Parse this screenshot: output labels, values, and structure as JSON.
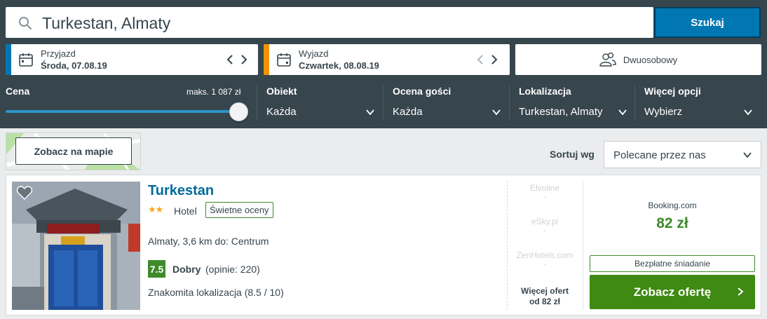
{
  "search": {
    "value": "Turkestan, Almaty",
    "button_label": "Szukaj"
  },
  "checkin": {
    "label": "Przyjazd",
    "date": "Środa, 07.08.19",
    "accent_color": "#0077b3"
  },
  "checkout": {
    "label": "Wyjazd",
    "date": "Czwartek, 08.08.19",
    "accent_color": "#f39200"
  },
  "room": {
    "label": "Dwuosobowy",
    "icon": "people-icon"
  },
  "filters": {
    "price": {
      "label": "Cena",
      "max_label": "maks. 1 087 zł",
      "slider_fraction": 1.0
    },
    "property": {
      "label": "Obiekt",
      "value": "Każda"
    },
    "guest_rating": {
      "label": "Ocena gości",
      "value": "Każda"
    },
    "location": {
      "label": "Lokalizacja",
      "value": "Turkestan, Almaty"
    },
    "more": {
      "label": "Więcej opcji",
      "value": "Wybierz"
    }
  },
  "map": {
    "button_label": "Zobacz na mapie"
  },
  "sort": {
    "label": "Sortuj wg",
    "value": "Polecane przez nas"
  },
  "result": {
    "name": "Turkestan",
    "stars": "★★",
    "star_count": 2,
    "type": "Hotel",
    "badge": "Świetne oceny",
    "location": "Almaty, 3,6 km do: Centrum",
    "score": "7.5",
    "rating_word": "Dobry",
    "reviews": "(opinie: 220)",
    "location_score": "Znakomita lokalizacja (8.5 / 10)",
    "other_offers": [
      {
        "name": "Elvoline",
        "price": "-"
      },
      {
        "name": "eSky.pl",
        "price": "-"
      },
      {
        "name": "ZenHotels.com",
        "price": "-"
      }
    ],
    "more_offers_line1": "Więcej ofert",
    "more_offers_line2": "od 82 zł",
    "provider": "Booking.com",
    "price": "82 zł",
    "perk": "Bezpłatne śniadanie",
    "cta_label": "Zobacz ofertę"
  },
  "colors": {
    "header_bg": "#37454d",
    "primary_blue": "#0077b3",
    "deal_green": "#3e8a12",
    "link_blue": "#006a9b"
  }
}
